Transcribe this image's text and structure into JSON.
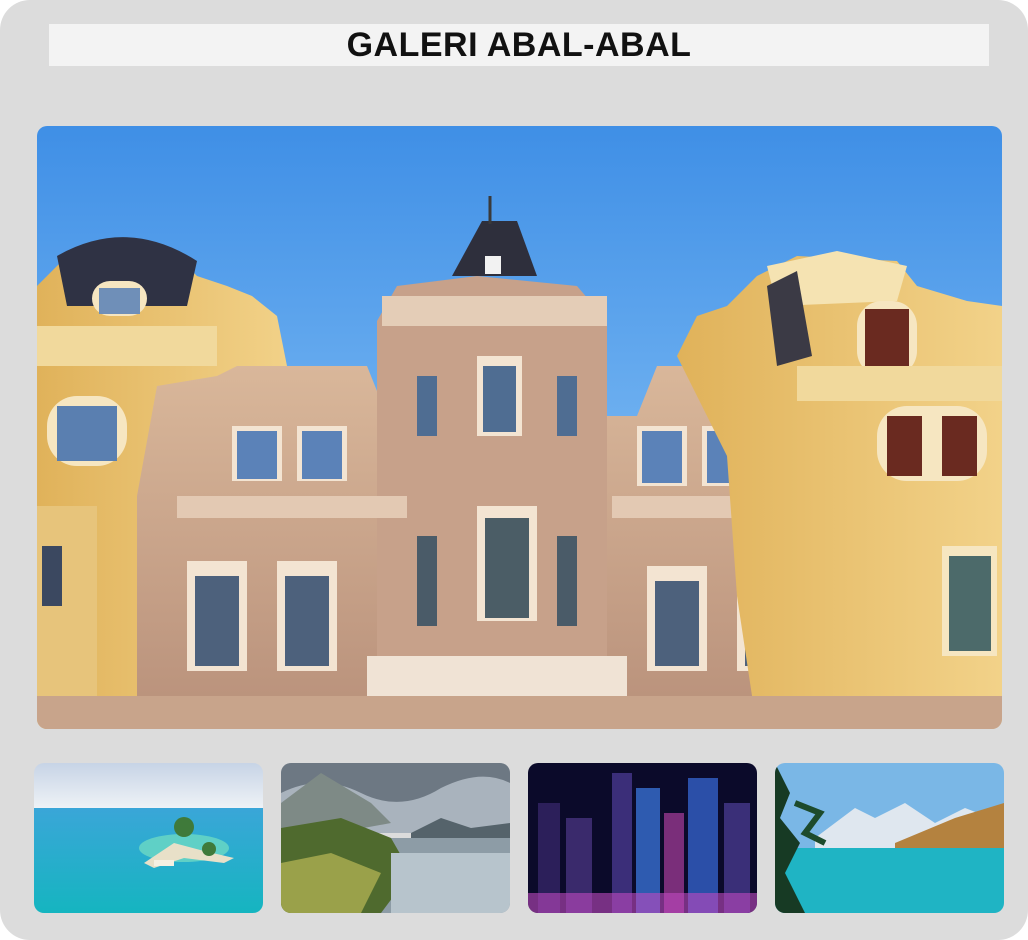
{
  "gallery": {
    "title": "GALERI ABAL-ABAL",
    "main_image": {
      "subject": "ornate-facade-building-photo",
      "selected_index": 0
    },
    "thumbnails": [
      {
        "subject": "tropical-island-photo"
      },
      {
        "subject": "mountain-lake-river-photo"
      },
      {
        "subject": "night-city-skyscrapers-photo"
      },
      {
        "subject": "turquoise-mountain-lake-photo"
      }
    ]
  },
  "colors": {
    "frame_background": "#dcdcdc",
    "title_background": "#f3f3f3",
    "title_text": "#111111"
  }
}
